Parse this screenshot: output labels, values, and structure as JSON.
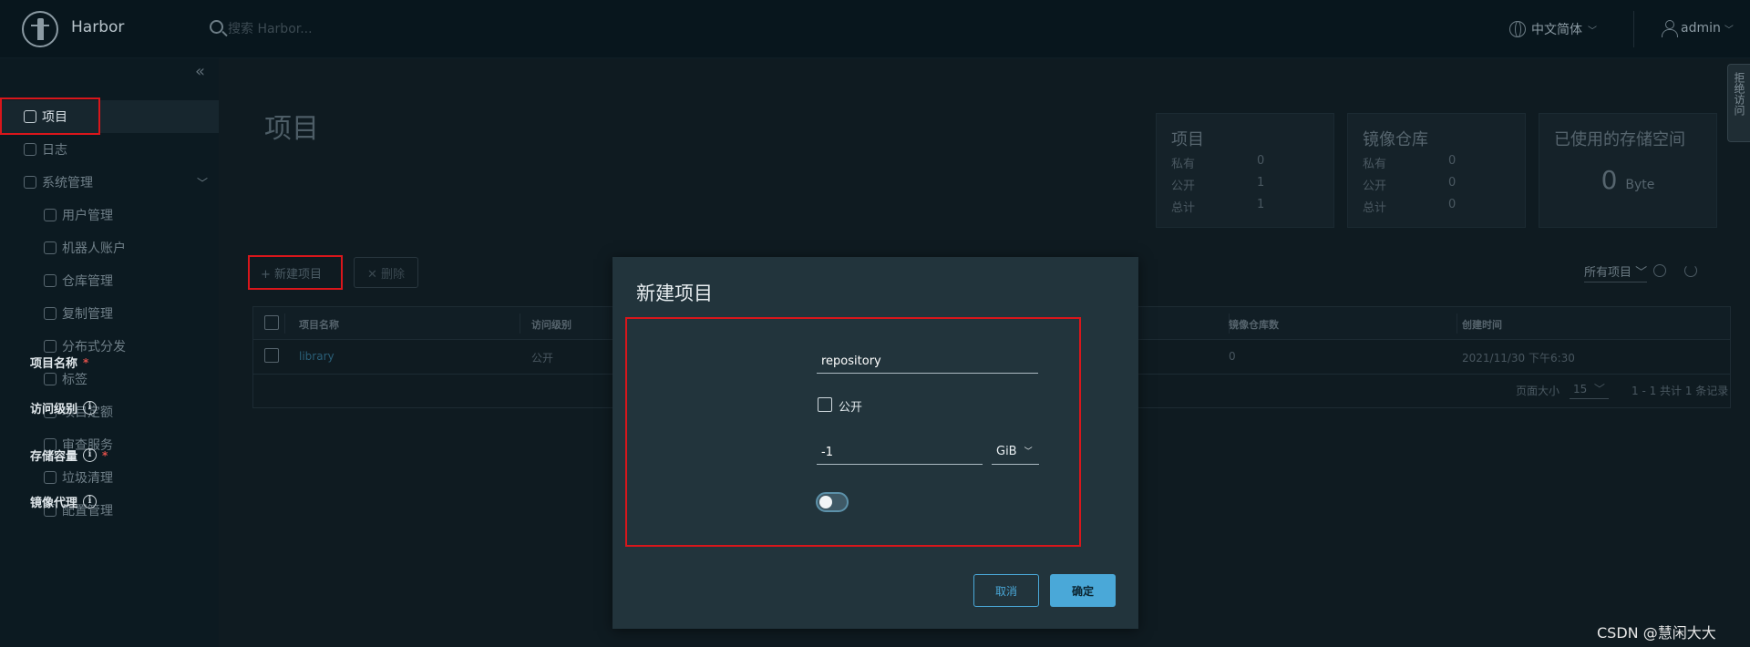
{
  "header": {
    "brand": "Harbor",
    "search_placeholder": "搜索 Harbor...",
    "language": "中文简体",
    "user": "admin"
  },
  "sidebar": {
    "items": [
      {
        "label": "项目",
        "level": "top",
        "active": true
      },
      {
        "label": "日志",
        "level": "top"
      },
      {
        "label": "系统管理",
        "level": "top",
        "expanded": true
      },
      {
        "label": "用户管理",
        "level": "sub"
      },
      {
        "label": "机器人账户",
        "level": "sub"
      },
      {
        "label": "仓库管理",
        "level": "sub"
      },
      {
        "label": "复制管理",
        "level": "sub"
      },
      {
        "label": "分布式分发",
        "level": "sub"
      },
      {
        "label": "标签",
        "level": "sub"
      },
      {
        "label": "项目定额",
        "level": "sub"
      },
      {
        "label": "审查服务",
        "level": "sub"
      },
      {
        "label": "垃圾清理",
        "level": "sub"
      },
      {
        "label": "配置管理",
        "level": "sub"
      }
    ]
  },
  "main": {
    "title": "项目",
    "side_tab": "拒绝访问",
    "cards": {
      "projects": {
        "title": "项目",
        "rows": [
          {
            "k": "私有",
            "v": "0"
          },
          {
            "k": "公开",
            "v": "1"
          },
          {
            "k": "总计",
            "v": "1"
          }
        ]
      },
      "repos": {
        "title": "镜像仓库",
        "rows": [
          {
            "k": "私有",
            "v": "0"
          },
          {
            "k": "公开",
            "v": "0"
          },
          {
            "k": "总计",
            "v": "0"
          }
        ]
      },
      "storage": {
        "title": "已使用的存储空间",
        "value": "0",
        "unit": "Byte"
      }
    },
    "toolbar": {
      "new_project": "+ 新建项目",
      "delete": "✕ 删除",
      "filter": "所有项目"
    },
    "table": {
      "headers": [
        "项目名称",
        "访问级别",
        "镜像仓库数",
        "创建时间"
      ],
      "rows": [
        {
          "name": "library",
          "access": "公开",
          "repo_count": "0",
          "created": "2021/11/30 下午6:30"
        }
      ],
      "page_size_label": "页面大小",
      "page_size": "15",
      "summary": "1 - 1 共计 1 条记录"
    }
  },
  "modal": {
    "title": "新建项目",
    "fields": {
      "name_label": "项目名称",
      "name_value": "repository",
      "access_label": "访问级别",
      "public_label": "公开",
      "public_checked": false,
      "storage_label": "存储容量",
      "storage_value": "-1",
      "storage_unit": "GiB",
      "proxy_label": "镜像代理",
      "proxy_enabled": false
    },
    "cancel": "取消",
    "ok": "确定"
  },
  "watermark": "CSDN @慧闲大大"
}
